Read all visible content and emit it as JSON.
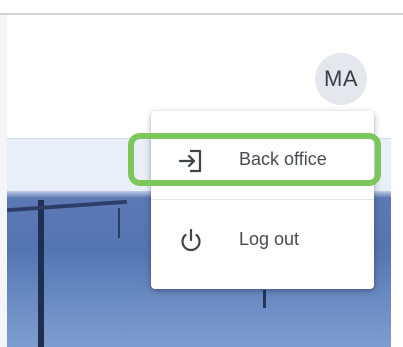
{
  "header": {
    "avatar_initials": "MA"
  },
  "user_menu": {
    "items": [
      {
        "label": "Back office",
        "icon": "sign-in-arrow-icon"
      },
      {
        "label": "Log out",
        "icon": "power-icon"
      }
    ]
  },
  "annotation": {
    "highlight_color": "#7dc75a",
    "highlighted_item": "Back office"
  }
}
